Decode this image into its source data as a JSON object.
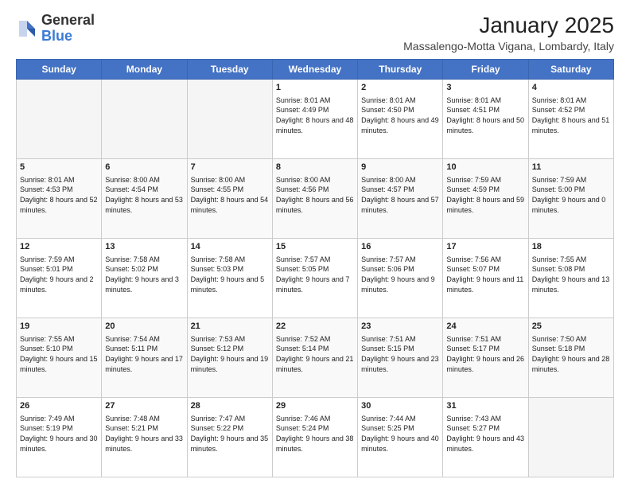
{
  "logo": {
    "general": "General",
    "blue": "Blue"
  },
  "header": {
    "month_year": "January 2025",
    "location": "Massalengo-Motta Vigana, Lombardy, Italy"
  },
  "days_of_week": [
    "Sunday",
    "Monday",
    "Tuesday",
    "Wednesday",
    "Thursday",
    "Friday",
    "Saturday"
  ],
  "weeks": [
    [
      {
        "day": "",
        "info": ""
      },
      {
        "day": "",
        "info": ""
      },
      {
        "day": "",
        "info": ""
      },
      {
        "day": "1",
        "info": "Sunrise: 8:01 AM\nSunset: 4:49 PM\nDaylight: 8 hours and 48 minutes."
      },
      {
        "day": "2",
        "info": "Sunrise: 8:01 AM\nSunset: 4:50 PM\nDaylight: 8 hours and 49 minutes."
      },
      {
        "day": "3",
        "info": "Sunrise: 8:01 AM\nSunset: 4:51 PM\nDaylight: 8 hours and 50 minutes."
      },
      {
        "day": "4",
        "info": "Sunrise: 8:01 AM\nSunset: 4:52 PM\nDaylight: 8 hours and 51 minutes."
      }
    ],
    [
      {
        "day": "5",
        "info": "Sunrise: 8:01 AM\nSunset: 4:53 PM\nDaylight: 8 hours and 52 minutes."
      },
      {
        "day": "6",
        "info": "Sunrise: 8:00 AM\nSunset: 4:54 PM\nDaylight: 8 hours and 53 minutes."
      },
      {
        "day": "7",
        "info": "Sunrise: 8:00 AM\nSunset: 4:55 PM\nDaylight: 8 hours and 54 minutes."
      },
      {
        "day": "8",
        "info": "Sunrise: 8:00 AM\nSunset: 4:56 PM\nDaylight: 8 hours and 56 minutes."
      },
      {
        "day": "9",
        "info": "Sunrise: 8:00 AM\nSunset: 4:57 PM\nDaylight: 8 hours and 57 minutes."
      },
      {
        "day": "10",
        "info": "Sunrise: 7:59 AM\nSunset: 4:59 PM\nDaylight: 8 hours and 59 minutes."
      },
      {
        "day": "11",
        "info": "Sunrise: 7:59 AM\nSunset: 5:00 PM\nDaylight: 9 hours and 0 minutes."
      }
    ],
    [
      {
        "day": "12",
        "info": "Sunrise: 7:59 AM\nSunset: 5:01 PM\nDaylight: 9 hours and 2 minutes."
      },
      {
        "day": "13",
        "info": "Sunrise: 7:58 AM\nSunset: 5:02 PM\nDaylight: 9 hours and 3 minutes."
      },
      {
        "day": "14",
        "info": "Sunrise: 7:58 AM\nSunset: 5:03 PM\nDaylight: 9 hours and 5 minutes."
      },
      {
        "day": "15",
        "info": "Sunrise: 7:57 AM\nSunset: 5:05 PM\nDaylight: 9 hours and 7 minutes."
      },
      {
        "day": "16",
        "info": "Sunrise: 7:57 AM\nSunset: 5:06 PM\nDaylight: 9 hours and 9 minutes."
      },
      {
        "day": "17",
        "info": "Sunrise: 7:56 AM\nSunset: 5:07 PM\nDaylight: 9 hours and 11 minutes."
      },
      {
        "day": "18",
        "info": "Sunrise: 7:55 AM\nSunset: 5:08 PM\nDaylight: 9 hours and 13 minutes."
      }
    ],
    [
      {
        "day": "19",
        "info": "Sunrise: 7:55 AM\nSunset: 5:10 PM\nDaylight: 9 hours and 15 minutes."
      },
      {
        "day": "20",
        "info": "Sunrise: 7:54 AM\nSunset: 5:11 PM\nDaylight: 9 hours and 17 minutes."
      },
      {
        "day": "21",
        "info": "Sunrise: 7:53 AM\nSunset: 5:12 PM\nDaylight: 9 hours and 19 minutes."
      },
      {
        "day": "22",
        "info": "Sunrise: 7:52 AM\nSunset: 5:14 PM\nDaylight: 9 hours and 21 minutes."
      },
      {
        "day": "23",
        "info": "Sunrise: 7:51 AM\nSunset: 5:15 PM\nDaylight: 9 hours and 23 minutes."
      },
      {
        "day": "24",
        "info": "Sunrise: 7:51 AM\nSunset: 5:17 PM\nDaylight: 9 hours and 26 minutes."
      },
      {
        "day": "25",
        "info": "Sunrise: 7:50 AM\nSunset: 5:18 PM\nDaylight: 9 hours and 28 minutes."
      }
    ],
    [
      {
        "day": "26",
        "info": "Sunrise: 7:49 AM\nSunset: 5:19 PM\nDaylight: 9 hours and 30 minutes."
      },
      {
        "day": "27",
        "info": "Sunrise: 7:48 AM\nSunset: 5:21 PM\nDaylight: 9 hours and 33 minutes."
      },
      {
        "day": "28",
        "info": "Sunrise: 7:47 AM\nSunset: 5:22 PM\nDaylight: 9 hours and 35 minutes."
      },
      {
        "day": "29",
        "info": "Sunrise: 7:46 AM\nSunset: 5:24 PM\nDaylight: 9 hours and 38 minutes."
      },
      {
        "day": "30",
        "info": "Sunrise: 7:44 AM\nSunset: 5:25 PM\nDaylight: 9 hours and 40 minutes."
      },
      {
        "day": "31",
        "info": "Sunrise: 7:43 AM\nSunset: 5:27 PM\nDaylight: 9 hours and 43 minutes."
      },
      {
        "day": "",
        "info": ""
      }
    ]
  ]
}
